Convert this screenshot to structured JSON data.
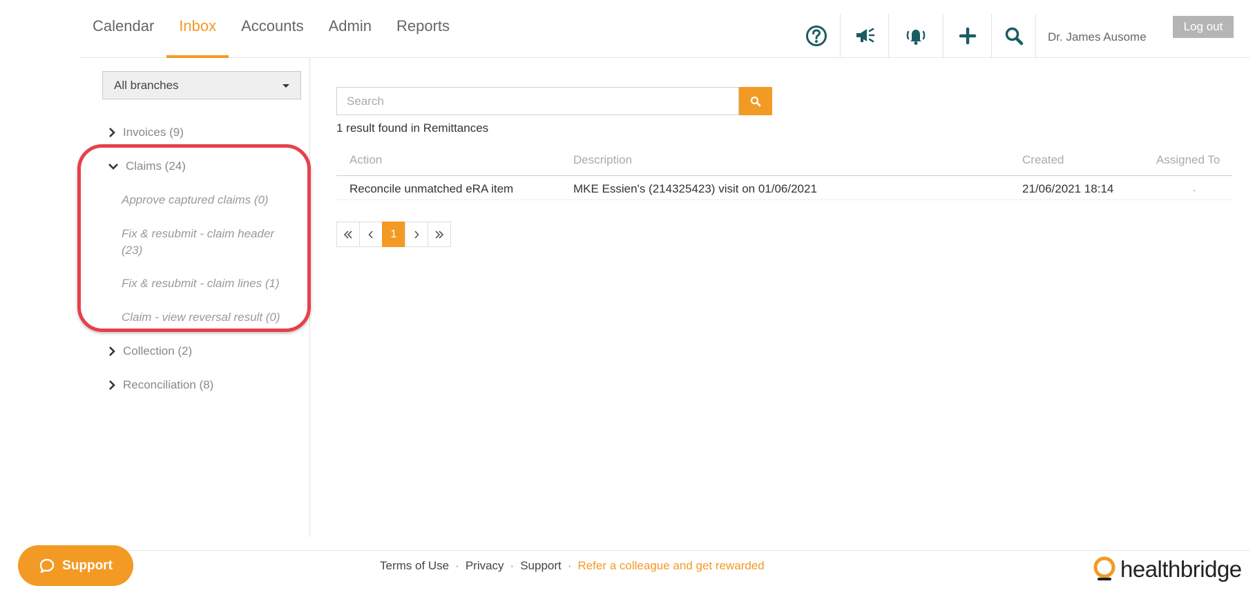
{
  "nav": {
    "tabs": [
      {
        "label": "Calendar",
        "active": false
      },
      {
        "label": "Inbox",
        "active": true
      },
      {
        "label": "Accounts",
        "active": false
      },
      {
        "label": "Admin",
        "active": false
      },
      {
        "label": "Reports",
        "active": false
      }
    ],
    "tools": [
      "help-icon",
      "megaphone-icon",
      "bell-icon",
      "plus-icon",
      "search-icon"
    ],
    "user_name": "Dr. James Ausome",
    "logout_label": "Log out"
  },
  "sidebar": {
    "branch_select": "All branches",
    "tree": {
      "invoices": "Invoices (9)",
      "claims": "Claims (24)",
      "claims_children": [
        "Approve captured claims (0)",
        "Fix & resubmit - claim header (23)",
        "Fix & resubmit - claim lines (1)",
        "Claim - view reversal result (0)"
      ],
      "collection": "Collection (2)",
      "reconciliation": "Reconciliation (8)"
    }
  },
  "main": {
    "search_placeholder": "Search",
    "result_text": "1 result found in Remittances",
    "table": {
      "headers": [
        "Action",
        "Description",
        "Created",
        "Assigned To"
      ],
      "rows": [
        {
          "action": "Reconcile unmatched eRA item",
          "description": "MKE Essien's (214325423) visit on 01/06/2021",
          "created": "21/06/2021 18:14",
          "assigned_to": "."
        }
      ]
    },
    "pagination": {
      "current_page": "1"
    }
  },
  "footer": {
    "support_label": "Support",
    "links": {
      "terms": "Terms of Use",
      "privacy": "Privacy",
      "support": "Support",
      "refer": "Refer a colleague and get rewarded"
    },
    "separator": "·",
    "logo_text": "healthbridge"
  },
  "colors": {
    "accent": "#f39a24",
    "icon_teal": "#1a5c63",
    "highlight_red": "#e8404a"
  }
}
